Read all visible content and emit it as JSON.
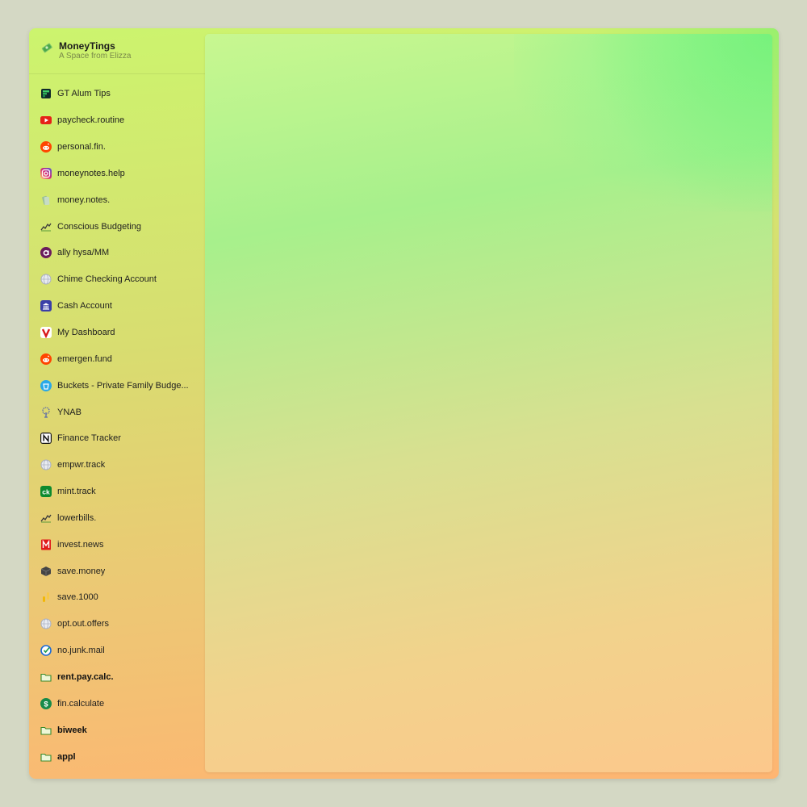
{
  "app": {
    "name": "MoneyTings",
    "subtitle": "A Space from Elizza"
  },
  "sidebar": {
    "items": [
      {
        "label": "GT Alum Tips",
        "icon": "stack-icon",
        "icon_color": "#1a9a4a",
        "bold": false
      },
      {
        "label": "paycheck.routine",
        "icon": "youtube-icon",
        "icon_color": "#e62117",
        "bold": false
      },
      {
        "label": "personal.fin.",
        "icon": "reddit-icon",
        "icon_color": "#ff4500",
        "bold": false
      },
      {
        "label": "moneynotes.help",
        "icon": "instagram-icon",
        "icon_color": "#d62976",
        "bold": false
      },
      {
        "label": "money.notes.",
        "icon": "money-icon",
        "icon_color": "#9cc09a",
        "bold": false
      },
      {
        "label": "Conscious Budgeting",
        "icon": "chart-line-icon",
        "icon_color": "#3a3a3a",
        "bold": false
      },
      {
        "label": "ally hysa/MM",
        "icon": "ally-icon",
        "icon_color": "#6a1b5c",
        "bold": false
      },
      {
        "label": "Chime Checking Account",
        "icon": "globe-icon",
        "icon_color": "#aab0c0",
        "bold": false
      },
      {
        "label": "Cash Account",
        "icon": "bank-icon",
        "icon_color": "#3b3fa8",
        "bold": false
      },
      {
        "label": "My Dashboard",
        "icon": "v-icon",
        "icon_color": "#d81b1b",
        "bold": false
      },
      {
        "label": "emergen.fund",
        "icon": "reddit-icon",
        "icon_color": "#ff4500",
        "bold": false
      },
      {
        "label": "Buckets - Private Family Budge...",
        "icon": "buckets-icon",
        "icon_color": "#2aa8e8",
        "bold": false
      },
      {
        "label": "YNAB",
        "icon": "tree-icon",
        "icon_color": "#5a6aa8",
        "bold": false
      },
      {
        "label": "Finance Tracker",
        "icon": "notion-icon",
        "icon_color": "#111111",
        "bold": false
      },
      {
        "label": "empwr.track",
        "icon": "globe-icon",
        "icon_color": "#aab0c0",
        "bold": false
      },
      {
        "label": "mint.track",
        "icon": "ck-icon",
        "icon_color": "#0c8a2e",
        "bold": false
      },
      {
        "label": "lowerbills.",
        "icon": "chart-line-icon",
        "icon_color": "#3a3a3a",
        "bold": false
      },
      {
        "label": "invest.news",
        "icon": "m-icon",
        "icon_color": "#e01b1b",
        "bold": false
      },
      {
        "label": "save.money",
        "icon": "cube-icon",
        "icon_color": "#444444",
        "bold": false
      },
      {
        "label": "save.1000",
        "icon": "coin-icon",
        "icon_color": "#f2b705",
        "bold": false
      },
      {
        "label": "opt.out.offers",
        "icon": "globe-icon",
        "icon_color": "#aab0c0",
        "bold": false
      },
      {
        "label": "no.junk.mail",
        "icon": "check-circle-icon",
        "icon_color": "#1a6ad8",
        "bold": false
      },
      {
        "label": "rent.pay.calc.",
        "icon": "folder-icon",
        "icon_color": "#3a8a2a",
        "bold": true
      },
      {
        "label": "fin.calculate",
        "icon": "dollar-circle-icon",
        "icon_color": "#178a4a",
        "bold": false
      },
      {
        "label": "biweek",
        "icon": "folder-icon",
        "icon_color": "#3a8a2a",
        "bold": true
      },
      {
        "label": "appl",
        "icon": "folder-icon",
        "icon_color": "#3a8a2a",
        "bold": true
      }
    ]
  }
}
